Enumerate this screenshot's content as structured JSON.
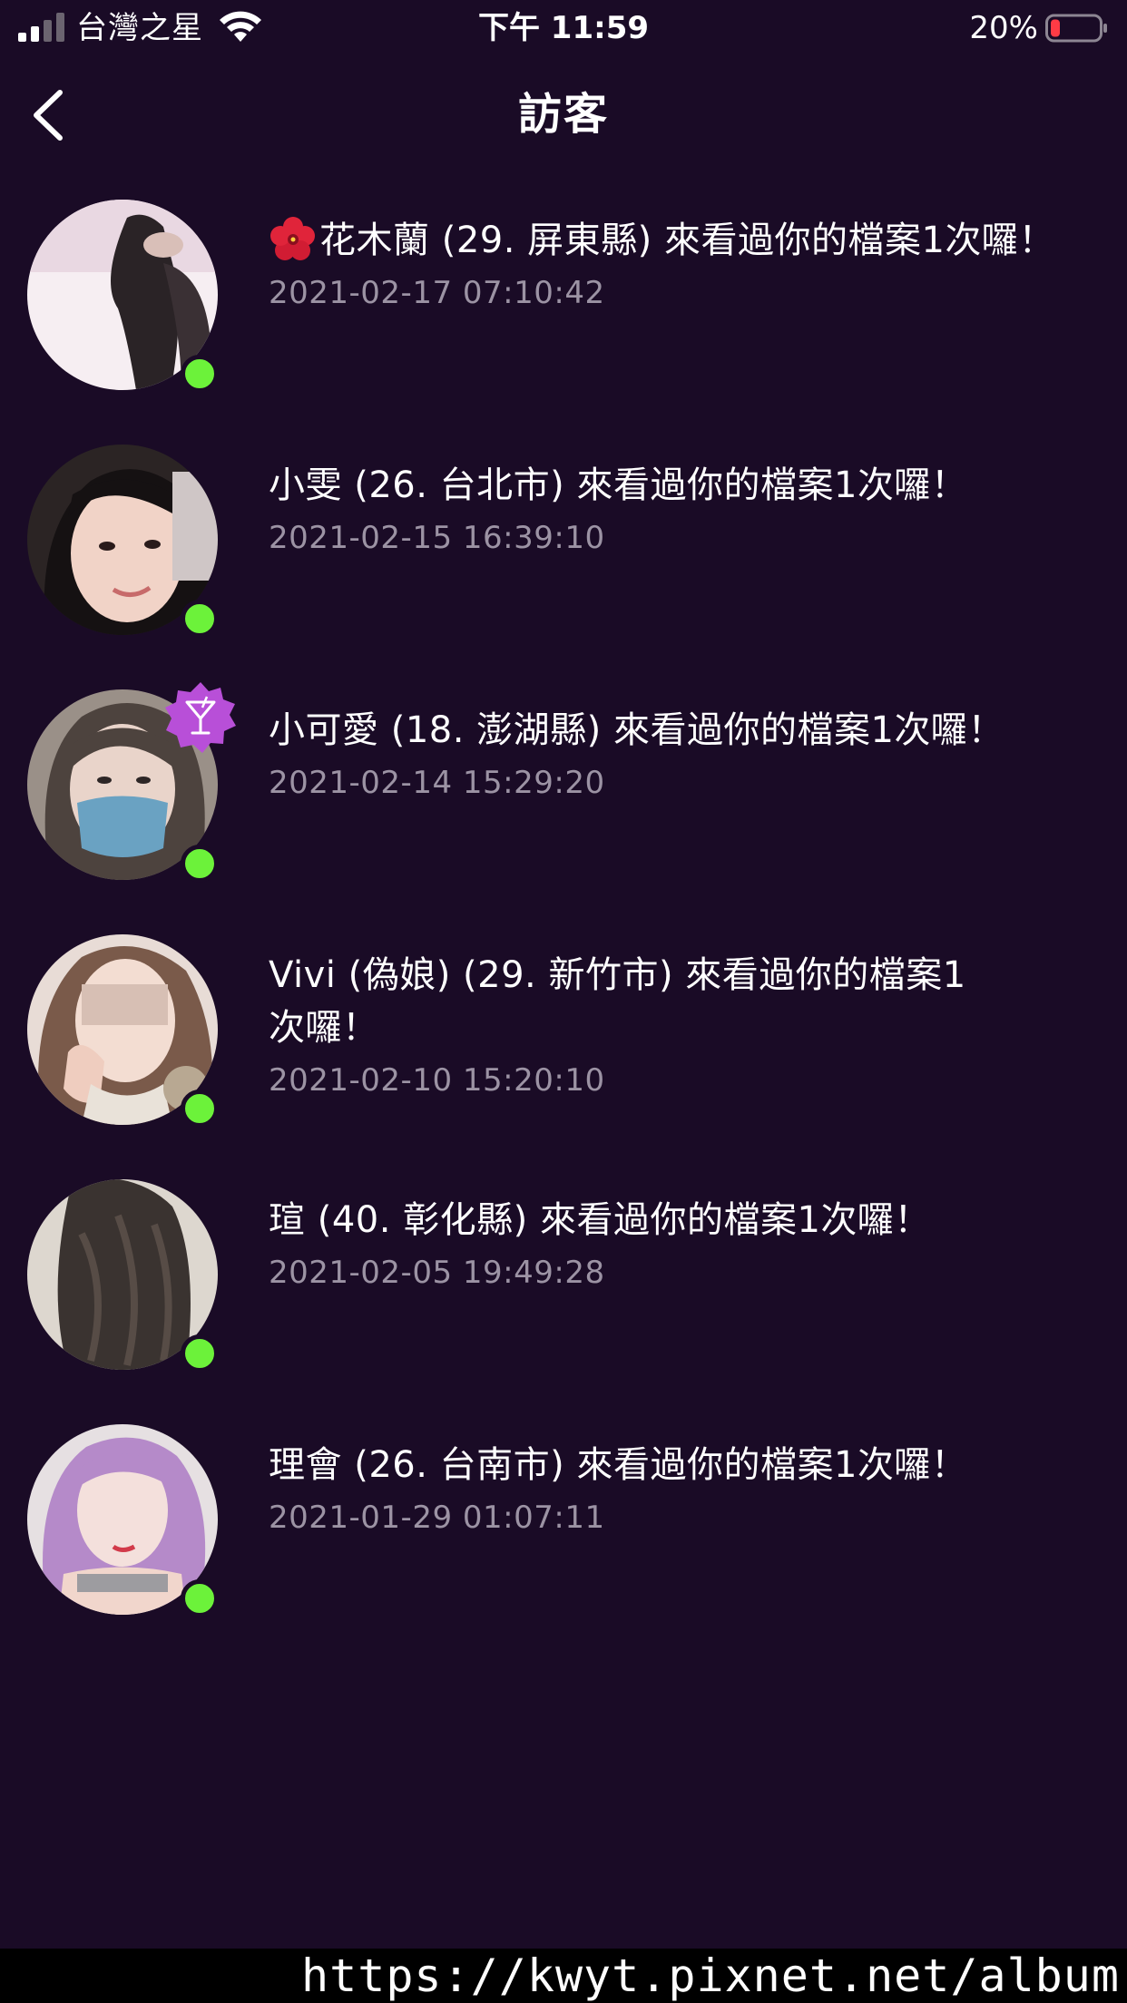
{
  "status_bar": {
    "carrier": "台灣之星",
    "time": "下午 11:59",
    "battery_percent": "20%",
    "battery_level": 0.2,
    "signal_bars_active": 2,
    "signal_bars_total": 4
  },
  "nav": {
    "title": "訪客"
  },
  "visitors": [
    {
      "message": "花木蘭 (29. 屏東縣) 來看過你的檔案1次囉！",
      "time": "2021-02-17 07:10:42",
      "online": true,
      "flower_icon": "hibiscus-icon"
    },
    {
      "message": "小雯 (26. 台北市) 來看過你的檔案1次囉！",
      "time": "2021-02-15 16:39:10",
      "online": true
    },
    {
      "message": "小可愛 (18. 澎湖縣) 來看過你的檔案1次囉！",
      "time": "2021-02-14 15:29:20",
      "online": true,
      "badge_icon": "cocktail-badge-icon"
    },
    {
      "message": "Vivi (偽娘) (29. 新竹市) 來看過你的檔案1次囉！",
      "time": "2021-02-10 15:20:10",
      "online": true
    },
    {
      "message": "瑄 (40. 彰化縣) 來看過你的檔案1次囉！",
      "time": "2021-02-05 19:49:28",
      "online": true
    },
    {
      "message": "理會 (26. 台南市) 來看過你的檔案1次囉！",
      "time": "2021-01-29 01:07:11",
      "online": true
    }
  ],
  "watermark": {
    "text": "https://kwyt.pixnet.net/album"
  },
  "colors": {
    "background": "#1a0b26",
    "online": "#6cf23a",
    "timestamp": "#9c93a4",
    "badge": "#b84fd8",
    "battery_low": "#ff3b45"
  }
}
